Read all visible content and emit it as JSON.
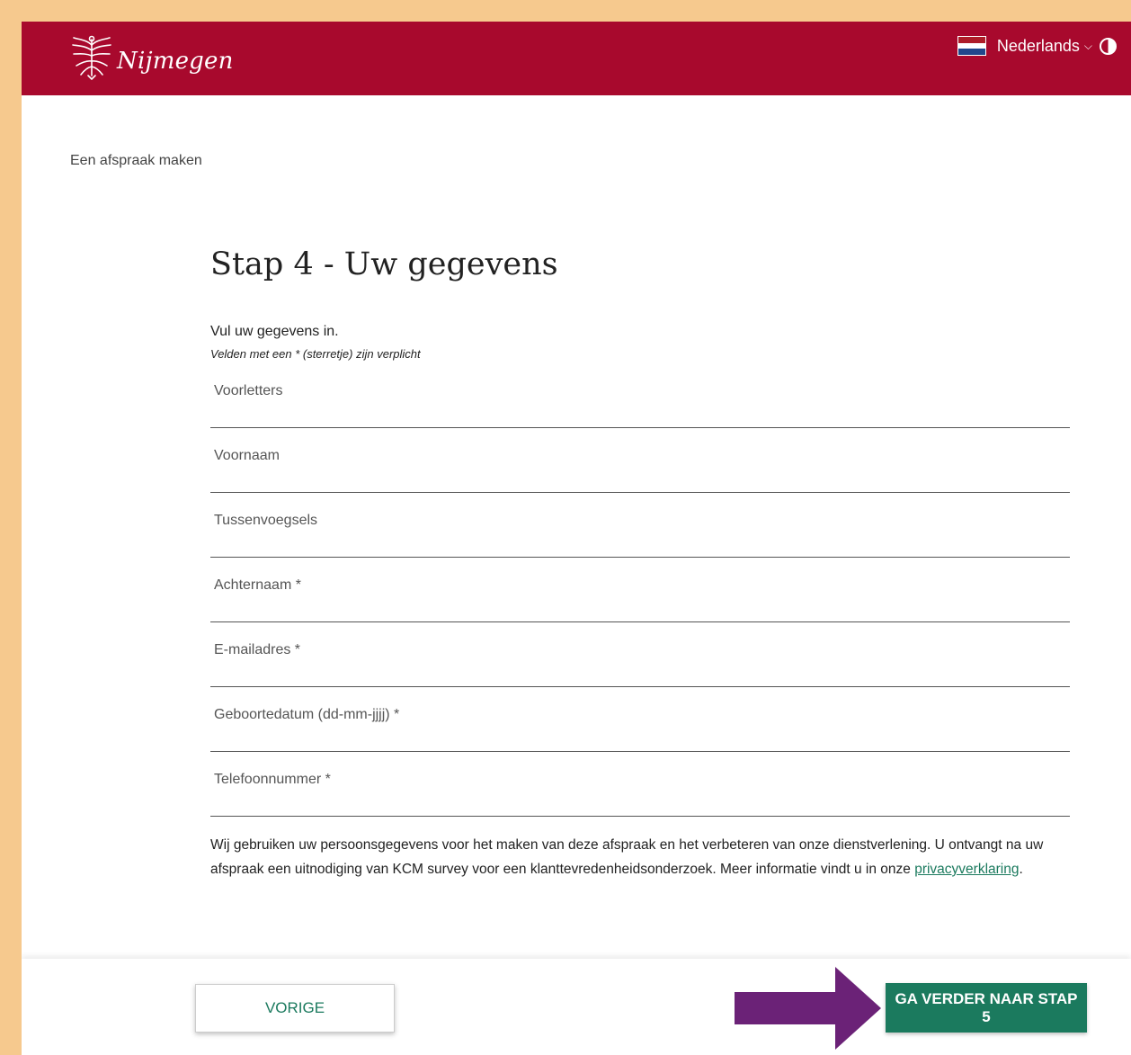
{
  "header": {
    "logo_text": "Nijmegen",
    "language": "Nederlands",
    "flag_colors": [
      "#ae1c28",
      "#ffffff",
      "#21468b"
    ],
    "brand_color": "#a8092d"
  },
  "breadcrumb": "Een afspraak maken",
  "form": {
    "title": "Stap 4 - Uw gegevens",
    "intro": "Vul uw gegevens in.",
    "required_note": "Velden met een * (sterretje) zijn verplicht",
    "fields": [
      {
        "placeholder": "Voorletters",
        "value": ""
      },
      {
        "placeholder": "Voornaam",
        "value": ""
      },
      {
        "placeholder": "Tussenvoegsels",
        "value": ""
      },
      {
        "placeholder": "Achternaam *",
        "value": ""
      },
      {
        "placeholder": "E-mailadres *",
        "value": ""
      },
      {
        "placeholder": "Geboortedatum (dd-mm-jjjj) *",
        "value": ""
      },
      {
        "placeholder": "Telefoonnummer *",
        "value": ""
      }
    ],
    "privacy_text": "Wij gebruiken uw persoonsgegevens voor het maken van deze afspraak en het verbeteren van onze dienstverlening. U ontvangt na uw afspraak een uitnodiging van KCM survey voor een klanttevredenheidsonderzoek. Meer informatie vindt u in onze ",
    "privacy_link": "privacyverklaring",
    "privacy_end": "."
  },
  "footer": {
    "prev_label": "VORIGE",
    "next_label": "GA VERDER NAAR STAP 5",
    "accent_color": "#1b7a5e",
    "annotation_arrow_color": "#6b2277"
  }
}
